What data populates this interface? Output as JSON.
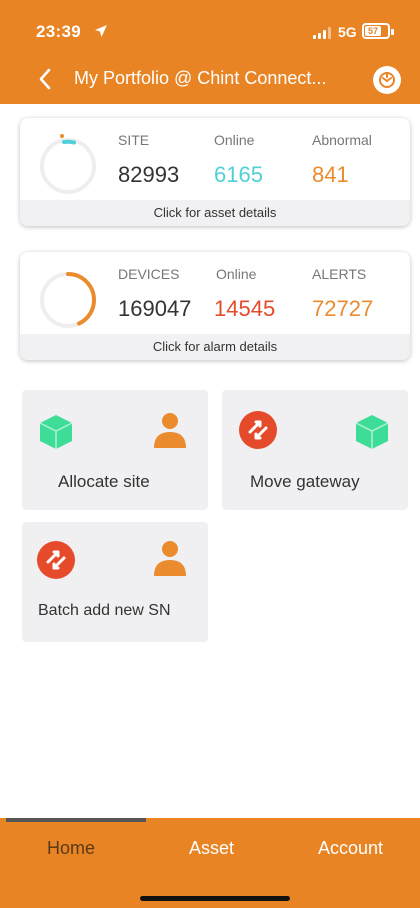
{
  "status_bar": {
    "time": "23:39",
    "network": "5G",
    "battery": "57"
  },
  "header": {
    "title": "My Portfolio @ Chint Connect..."
  },
  "site_card": {
    "labels": {
      "site": "SITE",
      "online": "Online",
      "abnormal": "Abnormal"
    },
    "values": {
      "site": "82993",
      "online": "6165",
      "abnormal": "841"
    },
    "footer": "Click for asset details"
  },
  "devices_card": {
    "labels": {
      "devices": "DEVICES",
      "online": "Online",
      "alerts": "ALERTS"
    },
    "values": {
      "devices": "169047",
      "online": "14545",
      "alerts": "72727"
    },
    "footer": "Click for alarm details",
    "ring_progress": 0.43
  },
  "actions": {
    "allocate_site": "Allocate site",
    "move_gateway": "Move gateway",
    "batch_add_sn": "Batch add new SN"
  },
  "tabs": {
    "home": "Home",
    "asset": "Asset",
    "account": "Account"
  },
  "colors": {
    "brand_orange": "#e98425",
    "online_teal": "#4fd0d8",
    "abnormal_orange": "#ea8c2e",
    "alert_red": "#e54b2a",
    "green_cube": "#3ddc97"
  }
}
